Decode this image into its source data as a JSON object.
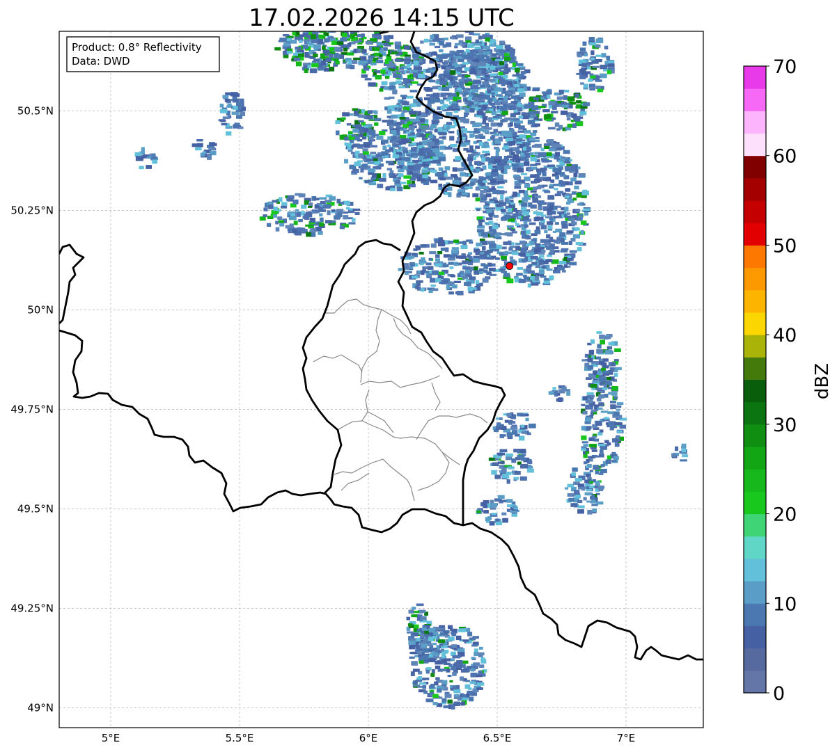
{
  "title": "17.02.2026 14:15 UTC",
  "info_box": {
    "product": "Product: 0.8° Reflectivity",
    "data": "Data: DWD"
  },
  "axes": {
    "lon_ticks": [
      "5°E",
      "5.5°E",
      "6°E",
      "6.5°E",
      "7°E"
    ],
    "lat_ticks": [
      "50.5°N",
      "50.25°N",
      "50°N",
      "49.75°N",
      "49.5°N",
      "49.25°N",
      "49°N"
    ],
    "lon_values": [
      5.0,
      5.5,
      6.0,
      6.5,
      7.0
    ],
    "lat_values": [
      50.5,
      50.25,
      50.0,
      49.75,
      49.5,
      49.25,
      49.0
    ],
    "lon_range": [
      4.8,
      7.3
    ],
    "lat_range": [
      48.95,
      50.7
    ]
  },
  "colorbar": {
    "label": "dBZ",
    "range": [
      0,
      70
    ],
    "tick_labels": [
      "0",
      "10",
      "20",
      "30",
      "40",
      "50",
      "60",
      "70"
    ],
    "colors": [
      "#6475a8",
      "#566a9f",
      "#4560a3",
      "#4b78b0",
      "#5a9ec8",
      "#63c0da",
      "#5fd6c6",
      "#3fd476",
      "#18c81c",
      "#16b81c",
      "#12a614",
      "#0f8e12",
      "#0b7611",
      "#095e0c",
      "#447a0c",
      "#aab308",
      "#fcd600",
      "#fcb400",
      "#fc9800",
      "#fc7800",
      "#e20000",
      "#c40000",
      "#a40000",
      "#800000",
      "#fce0fc",
      "#fcb4fc",
      "#f668f6",
      "#e83ae8"
    ]
  },
  "radar_site": {
    "lon": 6.548,
    "lat": 50.11,
    "color": "#ff0000"
  }
}
